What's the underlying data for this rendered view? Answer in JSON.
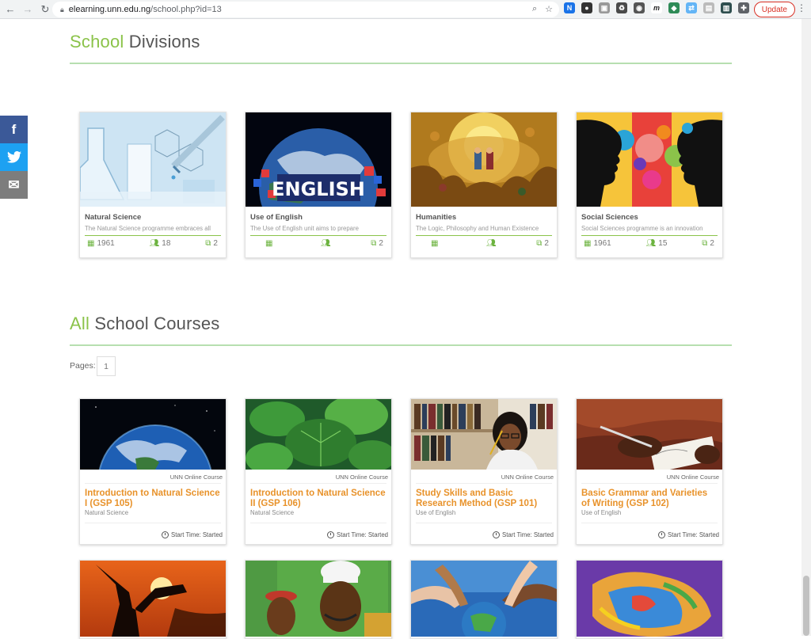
{
  "browser": {
    "url_host": "elearning.unn.edu.ng",
    "url_path": "/school.php?id=13",
    "update_label": "Update"
  },
  "social": {
    "facebook": "f",
    "twitter": "t",
    "email": "✉"
  },
  "divisions": {
    "title_accent": "School",
    "title_rest": " Divisions",
    "items": [
      {
        "name": "Natural Science",
        "desc": "The Natural Science programme embraces all",
        "year": "1961",
        "users": "18",
        "courses": "2"
      },
      {
        "name": "Use of English",
        "desc": "The Use of English unit aims to prepare",
        "year": "",
        "users": "",
        "courses": "2"
      },
      {
        "name": "Humanities",
        "desc": "The Logic, Philosophy and Human Existence",
        "year": "",
        "users": "",
        "courses": "2"
      },
      {
        "name": "Social Sciences",
        "desc": "Social Sciences programme is an innovation",
        "year": "1961",
        "users": "15",
        "courses": "2"
      }
    ]
  },
  "courses": {
    "title_accent": "All",
    "title_rest": " School Courses",
    "pages_label": "Pages:",
    "page_number": "1",
    "tag": "UNN Online Course",
    "start_label": "Start Time: Started",
    "items": [
      {
        "title": "Introduction to Natural Science I (GSP 105)",
        "division": "Natural Science"
      },
      {
        "title": "Introduction to Natural Science II (GSP 106)",
        "division": "Natural Science"
      },
      {
        "title": "Study Skills and Basic Research Method (GSP 101)",
        "division": "Use of English"
      },
      {
        "title": "Basic Grammar and Varieties of Writing (GSP 102)",
        "division": "Use of English"
      }
    ]
  },
  "colors": {
    "accent_green": "#8bc34a",
    "course_orange": "#e8922a"
  }
}
